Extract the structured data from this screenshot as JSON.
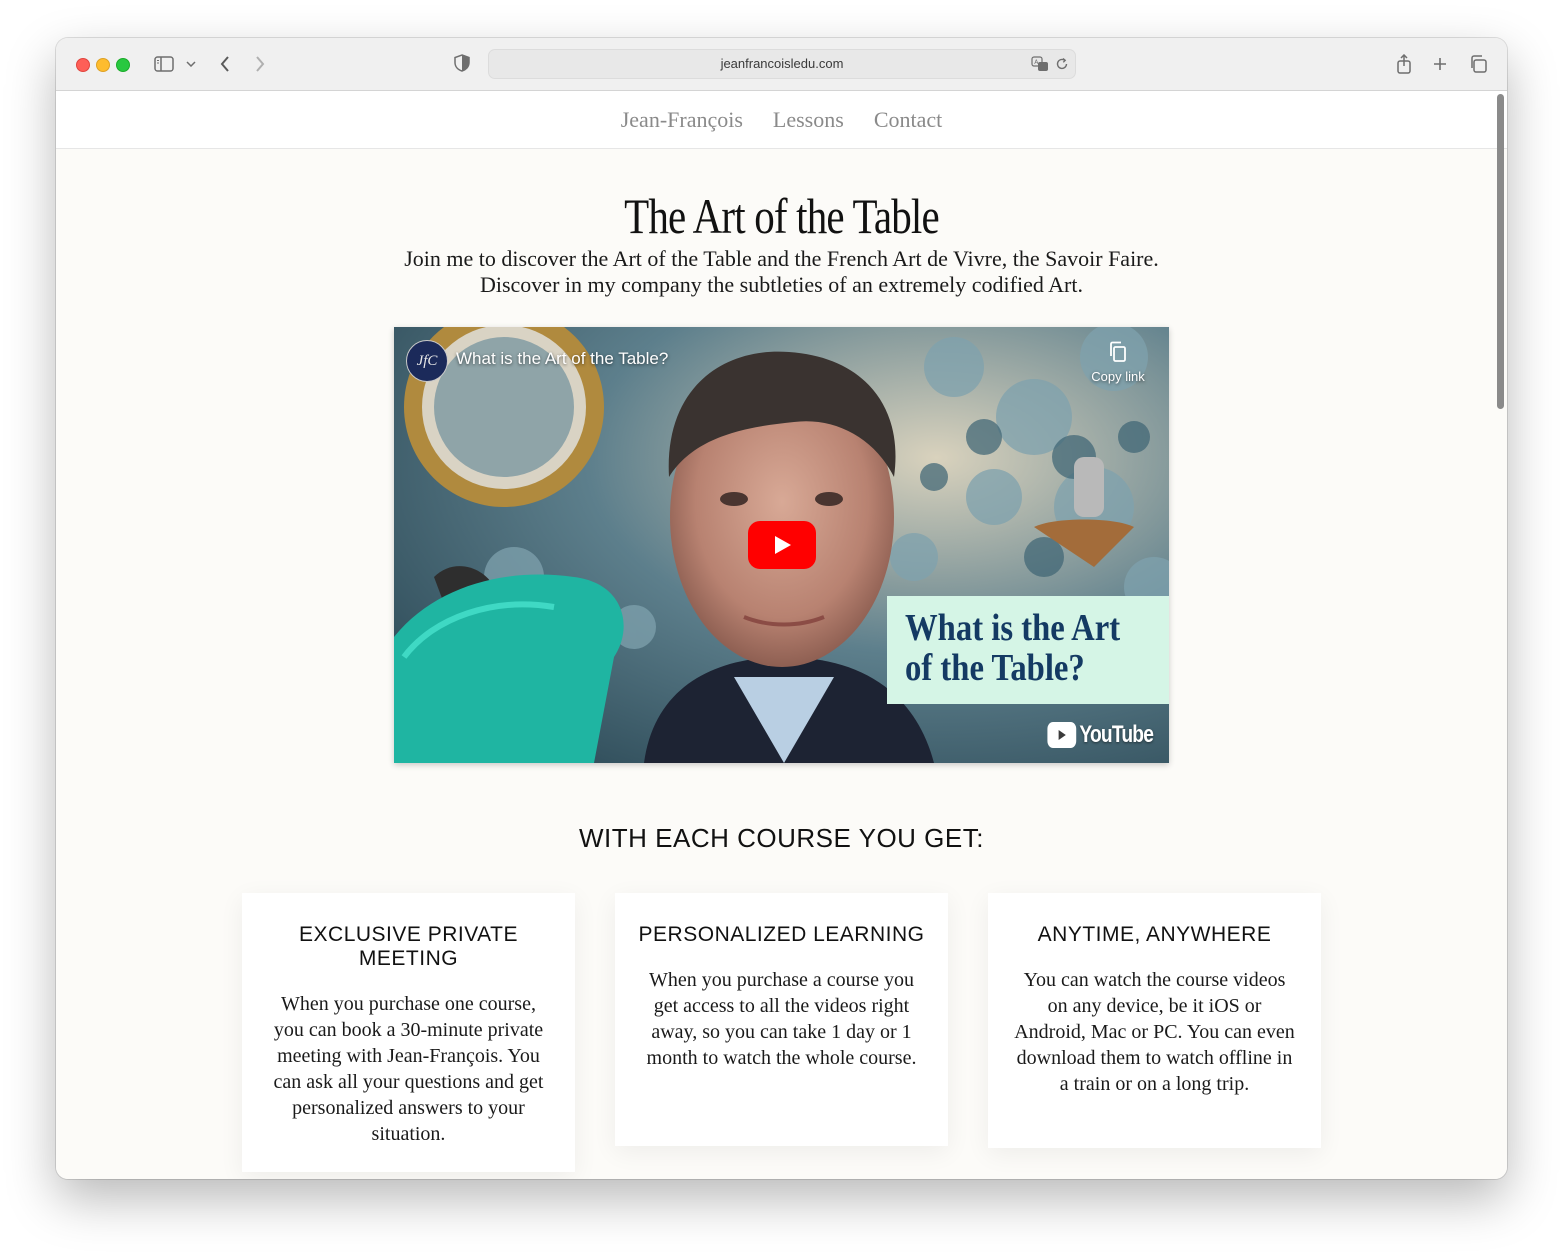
{
  "browser": {
    "url": "jeanfrancoisledu.com"
  },
  "nav": {
    "items": [
      "Jean-François",
      "Lessons",
      "Contact"
    ]
  },
  "hero": {
    "title": "The Art of the Table",
    "intro": "Join me to discover the Art of the Table and the French Art de Vivre, the Savoir Faire. Discover in my company the subtleties of an extremely codified Art."
  },
  "video": {
    "channel_logo": "JfC",
    "title": "What is the Art of the Table?",
    "copy_link": "Copy link",
    "card_text": "What is the Art of the Table?",
    "youtube_label": "YouTube"
  },
  "features": {
    "heading": "WITH EACH COURSE YOU GET:",
    "cards": [
      {
        "title": "EXCLUSIVE PRIVATE MEETING",
        "body": "When you purchase one course, you can book a 30-minute private meeting with Jean-François. You can ask all your questions and get personalized answers to your situation."
      },
      {
        "title": "PERSONALIZED LEARNING",
        "body": "When you purchase a course you get access to all the videos right away, so you can take 1 day or 1 month to watch the whole course."
      },
      {
        "title": "ANYTIME, ANYWHERE",
        "body": "You can watch the course videos on any device, be it iOS or Android, Mac or PC. You can even download them to watch offline in a train or on a long trip."
      }
    ]
  },
  "colors": {
    "youtube_red": "#ff0000",
    "card_green": "#d5f5e6",
    "card_navy": "#143a63"
  }
}
